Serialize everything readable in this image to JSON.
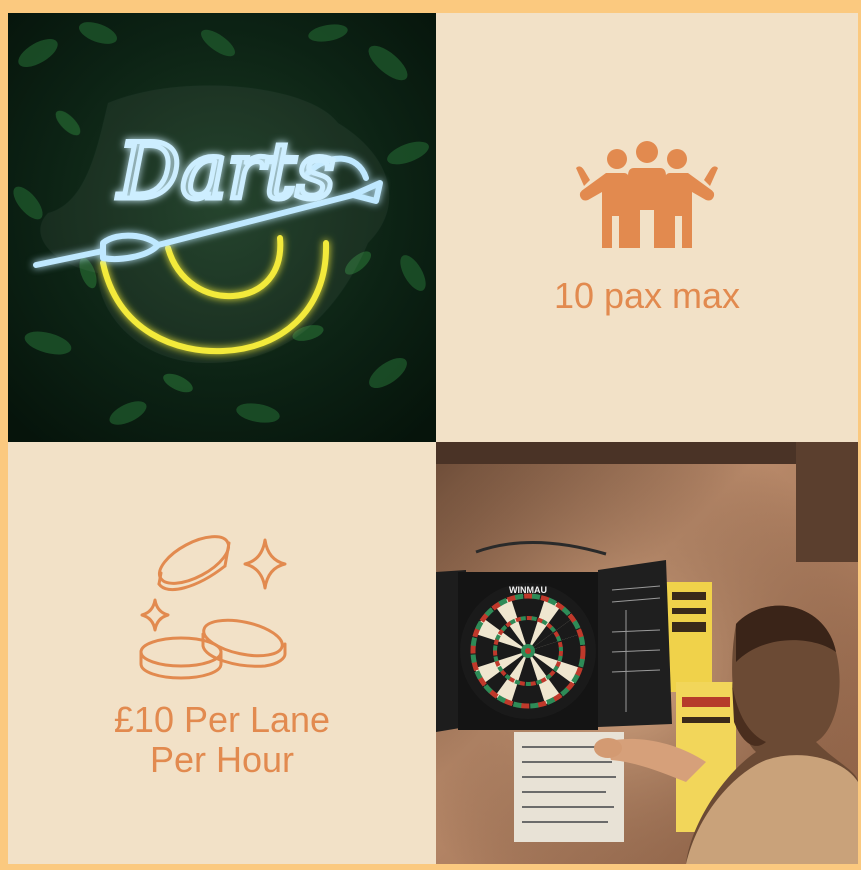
{
  "tiles": {
    "neon_photo": {
      "sign_text": "Darts"
    },
    "capacity": {
      "text": "10 pax max",
      "icon": "group-people-icon"
    },
    "price": {
      "line1": "£10 Per Lane",
      "line2": "Per Hour",
      "icon": "coins-sparkle-icon"
    },
    "dartboard_photo": {
      "board_brand": "WINMAU"
    }
  },
  "colors": {
    "frame": "#fbc97f",
    "tile_background": "#f2e1c7",
    "accent": "#e28a4f",
    "neon_blue": "#bfe8ff",
    "neon_yellow": "#f3ea3a"
  }
}
